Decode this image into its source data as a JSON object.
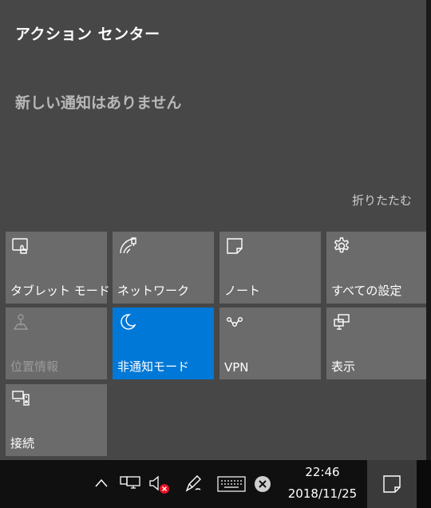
{
  "header": {
    "title": "アクション センター"
  },
  "notifications": {
    "empty_message": "新しい通知はありません"
  },
  "collapse_label": "折りたたむ",
  "tiles": [
    {
      "label": "タブレット モード",
      "icon": "tablet-mode-icon",
      "state": "off"
    },
    {
      "label": "ネットワーク",
      "icon": "network-icon",
      "state": "off"
    },
    {
      "label": "ノート",
      "icon": "note-icon",
      "state": "off"
    },
    {
      "label": "すべての設定",
      "icon": "gear-icon",
      "state": "off"
    },
    {
      "label": "位置情報",
      "icon": "location-icon",
      "state": "disabled"
    },
    {
      "label": "非通知モード",
      "icon": "moon-icon",
      "state": "on"
    },
    {
      "label": "VPN",
      "icon": "vpn-icon",
      "state": "off"
    },
    {
      "label": "表示",
      "icon": "display-icon",
      "state": "off"
    },
    {
      "label": "接続",
      "icon": "connect-icon",
      "state": "off"
    }
  ],
  "taskbar": {
    "tray_icons": [
      "chevron-up-icon",
      "network-wired-icon",
      "volume-muted-icon",
      "pen-icon",
      "keyboard-icon",
      "close-circle-icon"
    ],
    "time": "22:46",
    "date": "2018/11/25",
    "action_center_icon": "notification-icon"
  },
  "colors": {
    "panel": "#474747",
    "tile": "#6b6b6b",
    "tile_active": "#0078d7",
    "taskbar": "#101010",
    "muted_badge": "#e81123"
  }
}
